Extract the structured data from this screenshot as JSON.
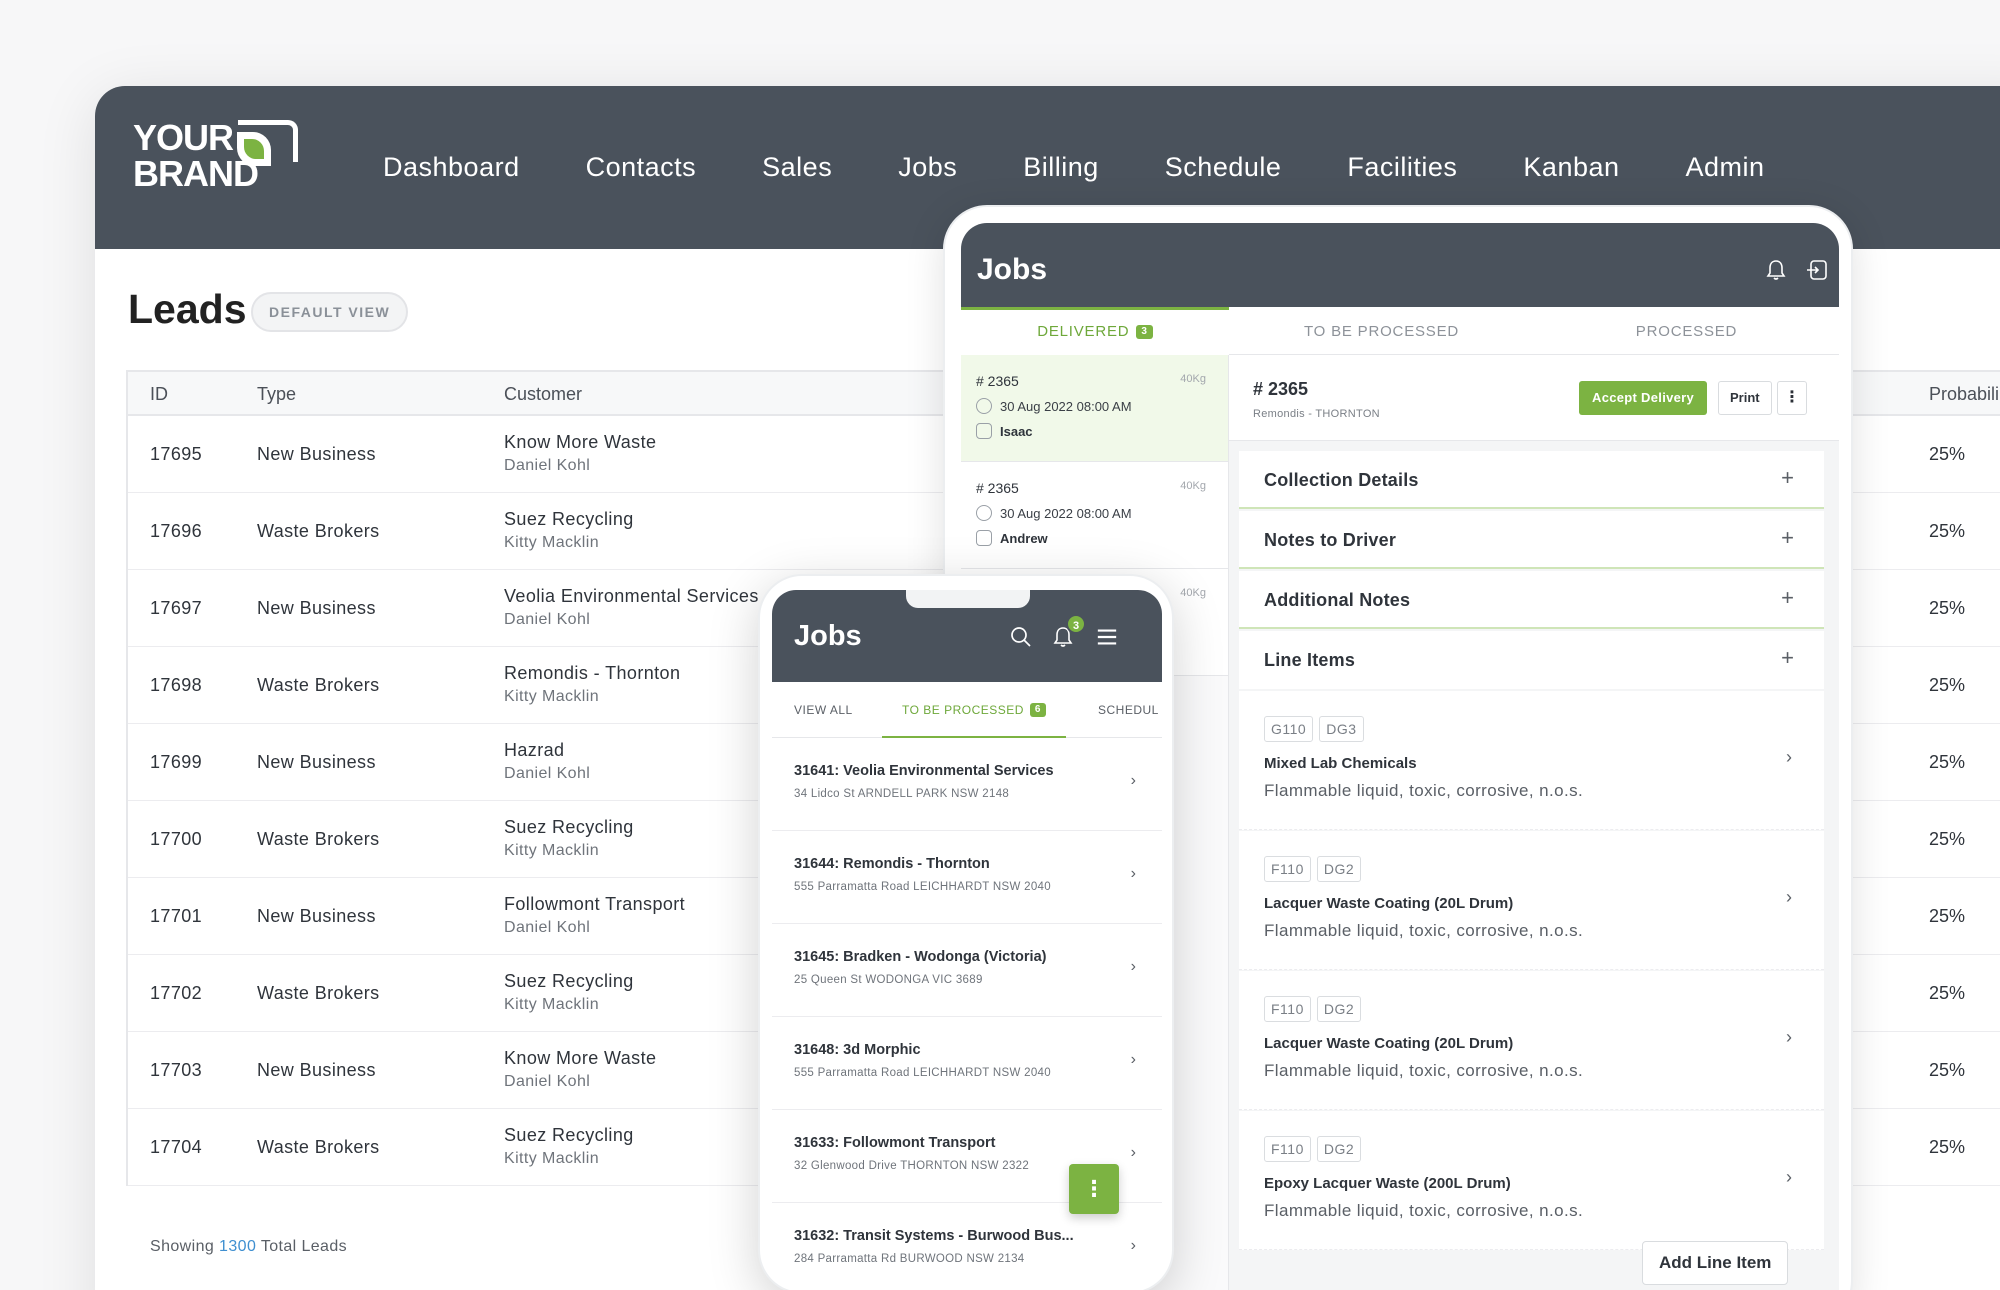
{
  "brand": {
    "line1": "YOUR",
    "line2": "BRAND"
  },
  "nav": [
    "Dashboard",
    "Contacts",
    "Sales",
    "Jobs",
    "Billing",
    "Schedule",
    "Facilities",
    "Kanban",
    "Admin"
  ],
  "leads": {
    "title": "Leads",
    "view_badge": "DEFAULT VIEW",
    "columns": {
      "id": "ID",
      "type": "Type",
      "customer": "Customer",
      "probability": "Probabili"
    },
    "rows": [
      {
        "id": "17695",
        "type": "New Business",
        "customer": "Know More Waste",
        "contact": "Daniel Kohl",
        "prob": "25%"
      },
      {
        "id": "17696",
        "type": "Waste Brokers",
        "customer": "Suez Recycling",
        "contact": "Kitty Macklin",
        "prob": "25%"
      },
      {
        "id": "17697",
        "type": "New Business",
        "customer": "Veolia Environmental Services",
        "contact": "Daniel Kohl",
        "prob": "25%"
      },
      {
        "id": "17698",
        "type": "Waste Brokers",
        "customer": "Remondis - Thornton",
        "contact": "Kitty Macklin",
        "prob": "25%"
      },
      {
        "id": "17699",
        "type": "New Business",
        "customer": "Hazrad",
        "contact": "Daniel Kohl",
        "prob": "25%"
      },
      {
        "id": "17700",
        "type": "Waste Brokers",
        "customer": "Suez Recycling",
        "contact": "Kitty Macklin",
        "prob": "25%"
      },
      {
        "id": "17701",
        "type": "New Business",
        "customer": "Followmont Transport",
        "contact": "Daniel Kohl",
        "prob": "25%"
      },
      {
        "id": "17702",
        "type": "Waste Brokers",
        "customer": "Suez Recycling",
        "contact": "Kitty Macklin",
        "prob": "25%"
      },
      {
        "id": "17703",
        "type": "New Business",
        "customer": "Know More Waste",
        "contact": "Daniel Kohl",
        "prob": "25%"
      },
      {
        "id": "17704",
        "type": "Waste Brokers",
        "customer": "Suez Recycling",
        "contact": "Kitty Macklin",
        "prob": "25%"
      }
    ],
    "footer": {
      "prefix": "Showing",
      "count": "1300",
      "suffix": "Total Leads"
    }
  },
  "tablet": {
    "title": "Jobs",
    "tabs": {
      "delivered": "DELIVERED",
      "delivered_count": "3",
      "to_be_processed": "TO BE PROCESSED",
      "processed": "PROCESSED"
    },
    "list": [
      {
        "no": "# 2365",
        "kg": "40Kg",
        "date": "30 Aug 2022 08:00 AM",
        "driver": "Isaac"
      },
      {
        "no": "# 2365",
        "kg": "40Kg",
        "date": "30 Aug 2022 08:00 AM",
        "driver": "Andrew"
      },
      {
        "no": "",
        "kg": "40Kg",
        "date": "",
        "driver": ""
      }
    ],
    "detail": {
      "no": "# 2365",
      "sub": "Remondis - THORNTON",
      "accept": "Accept Delivery",
      "print": "Print",
      "sections": [
        "Collection Details",
        "Notes to Driver",
        "Additional Notes",
        "Line Items"
      ],
      "line_items": [
        {
          "code": "G110",
          "dg": "DG3",
          "name": "Mixed Lab Chemicals",
          "desc": "Flammable liquid, toxic, corrosive, n.o.s."
        },
        {
          "code": "F110",
          "dg": "DG2",
          "name": "Lacquer Waste Coating (20L Drum)",
          "desc": "Flammable liquid, toxic, corrosive, n.o.s."
        },
        {
          "code": "F110",
          "dg": "DG2",
          "name": "Lacquer Waste Coating (20L Drum)",
          "desc": "Flammable liquid, toxic, corrosive, n.o.s."
        },
        {
          "code": "F110",
          "dg": "DG2",
          "name": "Epoxy Lacquer Waste (200L Drum)",
          "desc": "Flammable liquid, toxic, corrosive, n.o.s."
        }
      ],
      "add_line": "Add Line Item"
    }
  },
  "phone": {
    "title": "Jobs",
    "notif_count": "3",
    "tabs": {
      "view_all": "VIEW ALL",
      "to_be_processed": "TO BE PROCESSED",
      "to_be_processed_count": "6",
      "schedule": "SCHEDUL"
    },
    "jobs": [
      {
        "title": "31641: Veolia Environmental Services",
        "addr": "34 Lidco St ARNDELL PARK NSW 2148"
      },
      {
        "title": "31644: Remondis - Thornton",
        "addr": "555 Parramatta Road LEICHHARDT NSW 2040"
      },
      {
        "title": "31645: Bradken - Wodonga (Victoria)",
        "addr": "25 Queen St WODONGA VIC 3689"
      },
      {
        "title": "31648: 3d Morphic",
        "addr": "555 Parramatta Road LEICHHARDT NSW 2040"
      },
      {
        "title": "31633: Followmont Transport",
        "addr": "32 Glenwood Drive THORNTON NSW 2322"
      },
      {
        "title": "31632: Transit Systems - Burwood Bus...",
        "addr": "284 Parramatta Rd BURWOOD NSW 2134"
      }
    ]
  },
  "colors": {
    "header": "#4a525c",
    "accent": "#7cb342",
    "link": "#3f8fd0"
  }
}
